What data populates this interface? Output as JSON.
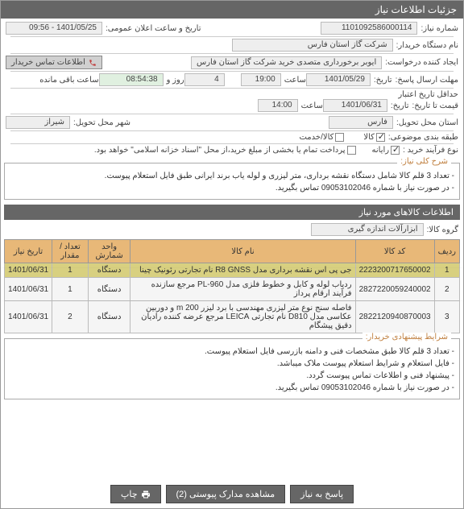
{
  "header": {
    "title": "جزئیات اطلاعات نیاز"
  },
  "fields": {
    "need_no_lbl": "شماره نیاز:",
    "need_no": "1101092586000114",
    "date_lbl": "تاریخ و ساعت اعلان عمومی:",
    "date_val": "1401/05/25 - 09:56",
    "org_lbl": "نام دستگاه خریدار:",
    "org_val": "شرکت گاز استان فارس",
    "creator_lbl": "ایجاد کننده درخواست:",
    "creator_val": "ایوبر برخورداری متصدی خرید شرکت گاز استان فارس",
    "contact_btn": "اطلاعات تماس خریدار",
    "deadline_lbl": "مهلت ارسال پاسخ:",
    "deadline_date": "1401/05/29",
    "time_lbl": "ساعت",
    "deadline_time": "19:00",
    "days_val": "4",
    "days_lbl": "روز و",
    "remain_time": "08:54:38",
    "remain_lbl": "ساعت باقی مانده",
    "tarikh_lbl": "تاریخ:",
    "valid_lbl": "حداقل تاریخ اعتبار",
    "valid_sub": "قیمت تا تاریخ:",
    "valid_date": "1401/06/31",
    "valid_time": "14:00",
    "province_lbl": "استان محل تحویل:",
    "province_val": "فارس",
    "city_lbl": "شهر محل تحویل:",
    "city_val": "شیراز",
    "classify_lbl": "طبقه بندی موضوعی:",
    "chk_kala": "کالا",
    "chk_khadamat": "کالا/خدمت",
    "process_lbl": "نوع فرآیند خرید :",
    "chk_rayane": "رایانه",
    "pay_text": "پرداخت تمام یا بخشی از مبلغ خرید،از محل \"اسناد خزانه اسلامی\" خواهد بود."
  },
  "summary": {
    "title": "شرح کلی نیاز:",
    "text1": "- تعداد 3 قلم کالا شامل دستگاه نقشه برداری، متر لیزری و لوله یاب برند ایرانی طبق فایل استعلام پیوست.",
    "text2": "- در صورت نیاز با شماره 09053102046 تماس بگیرید."
  },
  "items_section": {
    "title": "اطلاعات کالاهای مورد نیاز",
    "group_lbl": "گروه کالا:",
    "group_val": "ابزارآلات اندازه گیری"
  },
  "table": {
    "headers": {
      "row": "ردیف",
      "code": "کد کالا",
      "name": "نام کالا",
      "unit": "واحد شمارش",
      "qty": "تعداد / مقدار",
      "date": "تاریخ نیاز"
    },
    "rows": [
      {
        "n": "1",
        "code": "2223200717650002",
        "name": "جی پی اس نقشه برداری مدل R8 GNSS نام تجارتی رئونیک چینا",
        "unit": "دستگاه",
        "qty": "1",
        "date": "1401/06/31",
        "hl": true
      },
      {
        "n": "2",
        "code": "2827220059240002",
        "name": "ردیاب لوله و کابل و خطوط فلزی مدل PL-960 مرجع سازنده فرآیند ارقام پرداز",
        "unit": "دستگاه",
        "qty": "1",
        "date": "1401/06/31",
        "hl": false
      },
      {
        "n": "3",
        "code": "2822120940870003",
        "name": "فاصله سنج نوع متر لیزری مهندسی با برد لیزر 200 m و دوربین عکاسی مدل D810 نام تجارتی LEICA مرجع عرضه کننده رادیان دقیق پیشگام",
        "unit": "دستگاه",
        "qty": "2",
        "date": "1401/06/31",
        "hl": false
      }
    ]
  },
  "conditions": {
    "title": "شرایط پیشنهادی خریدار:",
    "l1": "- تعداد 3 قلم کالا طبق مشخصات فنی و دامنه بازرسی فایل استعلام پیوست.",
    "l2": "- فایل استعلام و شرایط استعلام پیوست ملاک میباشد.",
    "l3": "- پیشنهاد فنی و اطلاعات تماس پیوست گردد.",
    "l4": "- در صورت نیاز با شماره 09053102046 تماس بگیرید."
  },
  "footer": {
    "reply": "پاسخ به نیاز",
    "attach": "مشاهده مدارک پیوستی (2)",
    "print": "چاپ"
  }
}
